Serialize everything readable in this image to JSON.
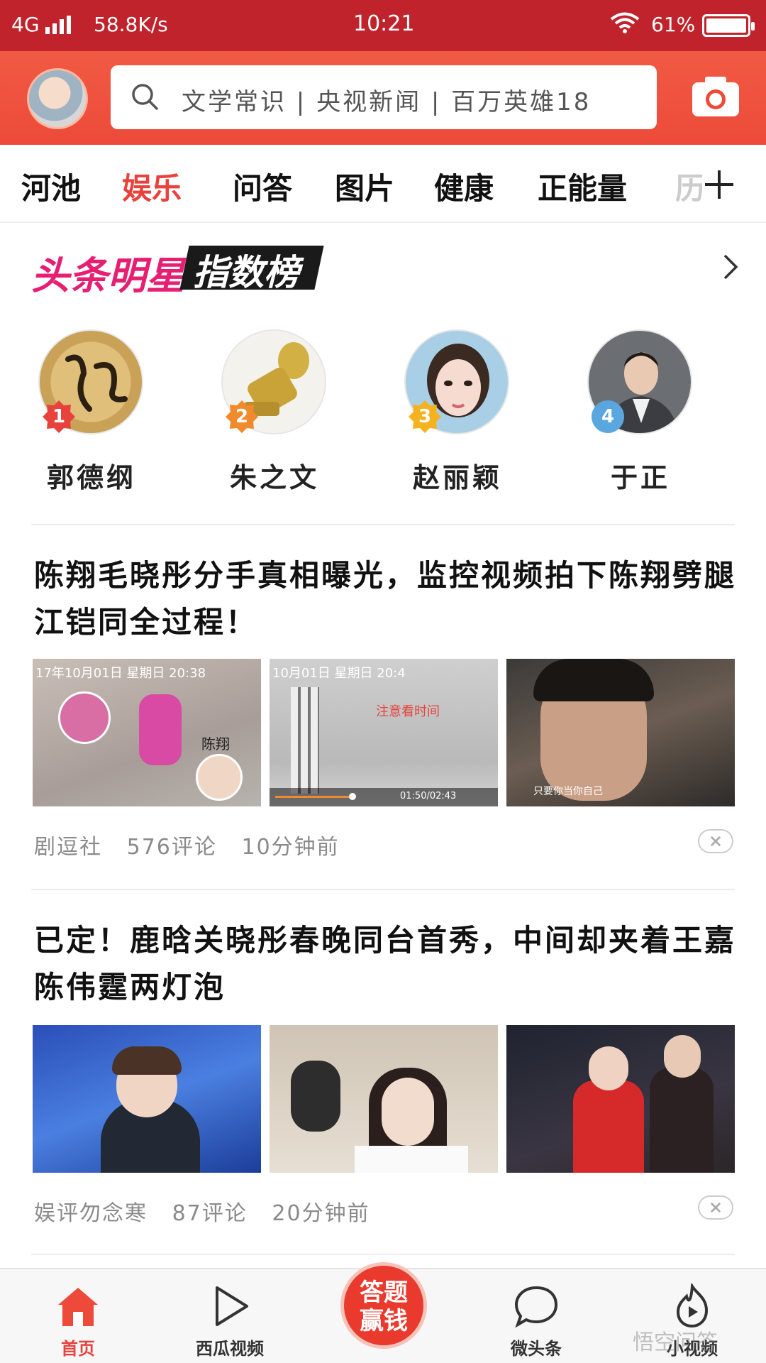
{
  "status_bar": {
    "network": "4G",
    "speed": "58.8K/s",
    "time": "10:21",
    "battery": "61%"
  },
  "header": {
    "search_suggestions": "文学常识 | 央视新闻 | 百万英雄18"
  },
  "tabs": [
    {
      "label": "河池",
      "active": false
    },
    {
      "label": "娱乐",
      "active": true
    },
    {
      "label": "问答",
      "active": false
    },
    {
      "label": "图片",
      "active": false
    },
    {
      "label": "健康",
      "active": false
    },
    {
      "label": "正能量",
      "active": false
    },
    {
      "label": "历",
      "active": false
    }
  ],
  "star_ranking": {
    "title_part1": "头条明星",
    "title_part2": "指数榜",
    "stars": [
      {
        "rank": "1",
        "name": "郭德纲",
        "badge_color": "#e8423c"
      },
      {
        "rank": "2",
        "name": "朱之文",
        "badge_color": "#f08a2c"
      },
      {
        "rank": "3",
        "name": "赵丽颖",
        "badge_color": "#f5b21f"
      },
      {
        "rank": "4",
        "name": "于正",
        "badge_color": "#5aa7e0"
      }
    ]
  },
  "articles": [
    {
      "title": "陈翔毛晓彤分手真相曝光，监控视频拍下陈翔劈腿江铠同全过程！",
      "source": "剧逗社",
      "comments": "576评论",
      "time": "10分钟前",
      "thumb_texts": {
        "t1_stamp": "17年10月01日 星期日 20:38",
        "t1_name": "陈翔",
        "t2_stamp": "10月01日 星期日 20:4",
        "t2_note": "注意看时间",
        "t2_time": "01:50/02:43",
        "t3_caption": "只要你当你自己"
      }
    },
    {
      "title": "已定！鹿晗关晓彤春晚同台首秀，中间却夹着王嘉陈伟霆两灯泡",
      "source": "娱评勿念寒",
      "comments": "87评论",
      "time": "20分钟前"
    }
  ],
  "bottom_nav": {
    "home": "首页",
    "xigua": "西瓜视频",
    "quiz": "答题赢钱",
    "weitoutiao": "微头条",
    "small_video": "小视频"
  },
  "watermark": "悟空问答",
  "colors": {
    "accent": "#e8423c",
    "header_bg": "#ee4a3a",
    "status_bg": "#c0232b"
  }
}
